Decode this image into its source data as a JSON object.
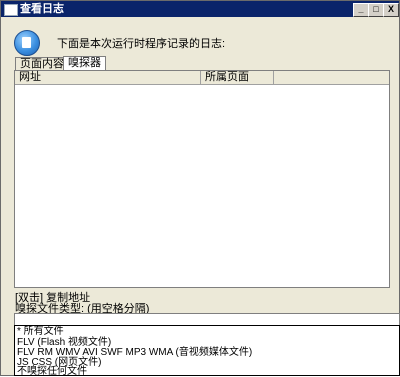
{
  "window": {
    "title": "查看日志",
    "min_label": "_",
    "max_label": "□",
    "close_label": "X"
  },
  "header": {
    "message": "下面是本次运行时程序记录的日志:"
  },
  "tabs": [
    {
      "label": "页面内容",
      "active": false
    },
    {
      "label": "嗅探器",
      "active": true
    }
  ],
  "list": {
    "columns": [
      "网址",
      "所属页面"
    ],
    "rows": []
  },
  "hints": {
    "double_click": "[双击] 复制地址",
    "type_label": "嗅探文件类型: (用空格分隔)"
  },
  "type_input": {
    "value": ""
  },
  "dropdown": {
    "options": [
      "* 所有文件",
      "FLV (Flash 视频文件)",
      "FLV RM WMV AVI SWF MP3 WMA (音视频媒体文件)",
      "JS CSS (网页文件)",
      "不嗅探任何文件"
    ]
  }
}
